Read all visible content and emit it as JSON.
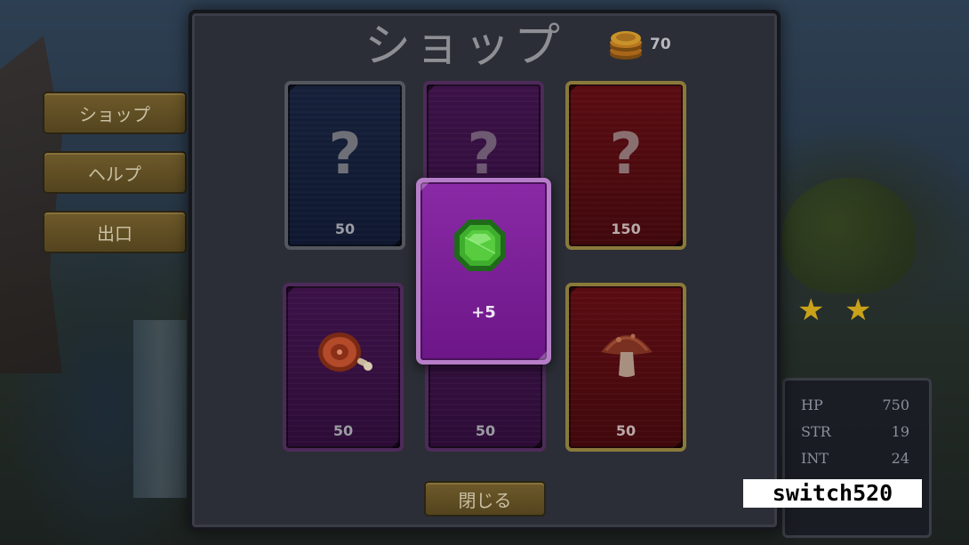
{
  "shop": {
    "title": "ショップ",
    "coins": "70"
  },
  "side_menu": {
    "shop_label": "ショップ",
    "help_label": "ヘルプ",
    "exit_label": "出口"
  },
  "cards": [
    {
      "kind": "mystery",
      "color": "#16203a",
      "icon": "question-mark",
      "symbol": "?",
      "price": "50"
    },
    {
      "kind": "mystery",
      "color": "#3c1248",
      "icon": "question-mark",
      "symbol": "?",
      "price": ""
    },
    {
      "kind": "mystery",
      "color": "#5a0c12",
      "icon": "question-mark",
      "symbol": "?",
      "price": "150"
    },
    {
      "kind": "item",
      "color": "#3c1248",
      "icon": "meat-icon",
      "price": "50"
    },
    {
      "kind": "item",
      "color": "#3c1248",
      "icon": "unknown",
      "price": "50"
    },
    {
      "kind": "item",
      "color": "#5a0c12",
      "icon": "mushroom-icon",
      "price": "50"
    }
  ],
  "popup": {
    "icon": "emerald-gem-icon",
    "value": "+5",
    "color": "#8a2aa6"
  },
  "close_button": {
    "label": "閉じる"
  },
  "stats": [
    {
      "name": "HP",
      "value": "750"
    },
    {
      "name": "STR",
      "value": "19"
    },
    {
      "name": "INT",
      "value": "24"
    }
  ],
  "watermark": "switch520"
}
